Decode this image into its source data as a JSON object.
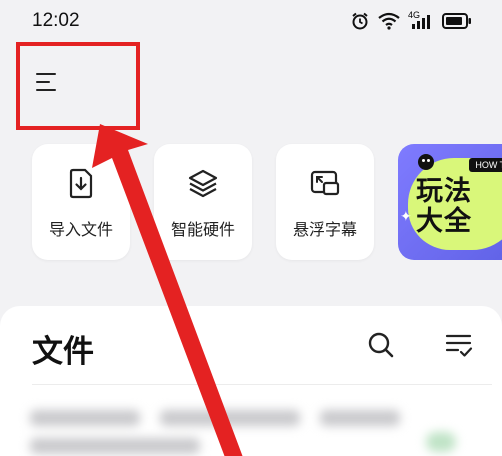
{
  "status": {
    "time": "12:02",
    "network_label": "4G"
  },
  "toolbar": {
    "menu_icon": "hamburger-menu-icon"
  },
  "quick_actions": [
    {
      "label": "导入文件",
      "icon": "import-file-icon"
    },
    {
      "label": "智能硬件",
      "icon": "layers-icon"
    },
    {
      "label": "悬浮字幕",
      "icon": "floating-subtitle-icon"
    }
  ],
  "promo": {
    "text_line1": "玩法",
    "text_line2": "大全",
    "tag": "HOW TO"
  },
  "files": {
    "title": "文件",
    "search_icon": "search-icon",
    "sort_icon": "list-check-icon"
  },
  "annotation": {
    "highlight_color": "#e42222"
  }
}
